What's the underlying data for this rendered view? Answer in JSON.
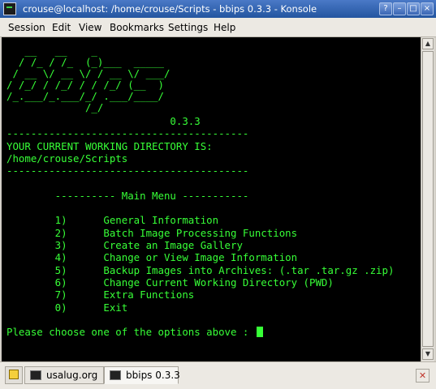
{
  "window": {
    "title": "crouse@localhost: /home/crouse/Scripts - bbips 0.3.3 - Konsole",
    "buttons": {
      "help": "?",
      "minimize": "–",
      "maximize": "□",
      "close": "×"
    }
  },
  "menubar": {
    "items": [
      "Session",
      "Edit",
      "View",
      "Bookmarks",
      "Settings",
      "Help"
    ]
  },
  "terminal": {
    "lines": [
      "   __   __    _",
      "  / /_ / /_  (_)___  _____",
      " / __ \\/ __ \\/ / __ \\/ ___/",
      "/ /_/ / /_/ / / /_/ (__  )",
      "/_.___/_.___/_/ .___/____/",
      "             /_/",
      "                           0.3.3",
      "----------------------------------------",
      "YOUR CURRENT WORKING DIRECTORY IS:",
      "/home/crouse/Scripts",
      "----------------------------------------",
      "",
      "        ---------- Main Menu -----------",
      "",
      "        1)      General Information",
      "        2)      Batch Image Processing Functions",
      "        3)      Create an Image Gallery",
      "        4)      Change or View Image Information",
      "        5)      Backup Images into Archives: (.tar .tar.gz .zip)",
      "        6)      Change Current Working Directory (PWD)",
      "        7)      Extra Functions",
      "        0)      Exit",
      "",
      "Please choose one of the options above : "
    ],
    "text_color": "#37ff37",
    "background": "#000000"
  },
  "tabbar": {
    "tabs": [
      {
        "label": "usalug.org",
        "active": false
      },
      {
        "label": "bbips 0.3.3",
        "active": true
      }
    ],
    "new_tab_icon": "new-session-icon",
    "close_tab_icon": "close-tab-icon"
  },
  "colors": {
    "titlebar": "#3566b6",
    "chrome": "#ece9e3"
  }
}
